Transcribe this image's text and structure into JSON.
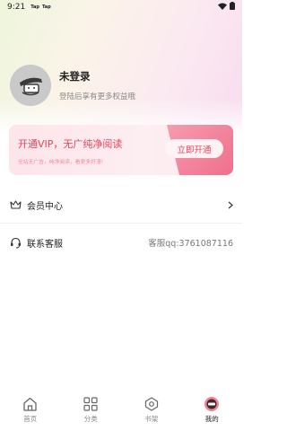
{
  "status_bar": {
    "time": "9:21",
    "apps": [
      "Tap",
      "Tap"
    ]
  },
  "profile": {
    "name": "未登录",
    "subtitle": "登陆后享有更多权益哦"
  },
  "vip": {
    "title": "开通VIP，无广纯净阅读",
    "desc": "全站无广告，纯净阅读，看更多好漫!",
    "button": "立即开通"
  },
  "menu": [
    {
      "label": "会员中心",
      "icon": "crown-icon",
      "right": ""
    },
    {
      "label": "联系客服",
      "icon": "headset-icon",
      "right": "客服qq:3761087116"
    }
  ],
  "nav": [
    {
      "label": "首页",
      "icon": "home-icon"
    },
    {
      "label": "分类",
      "icon": "grid-icon"
    },
    {
      "label": "书架",
      "icon": "bookshelf-icon"
    },
    {
      "label": "我的",
      "icon": "profile-icon",
      "active": true
    }
  ],
  "colors": {
    "accent": "#e4445f",
    "accent_light": "#fde5ea"
  }
}
